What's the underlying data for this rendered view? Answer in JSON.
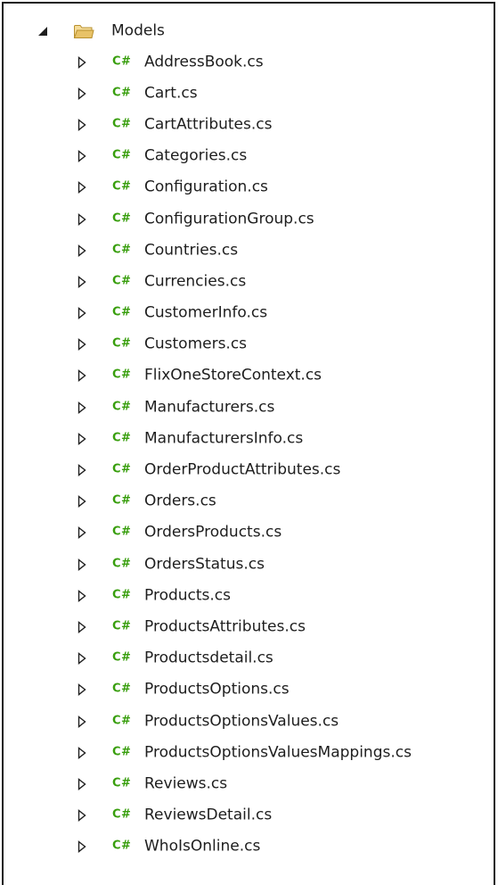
{
  "tree": {
    "root": {
      "label": "Models",
      "icon": "folder-open-icon",
      "expander_icon": "triangle-expanded-icon"
    },
    "file_badge": "C#",
    "file_icon": "csharp-file-icon",
    "collapsed_icon": "triangle-collapsed-icon",
    "files": [
      {
        "label": "AddressBook.cs"
      },
      {
        "label": "Cart.cs"
      },
      {
        "label": "CartAttributes.cs"
      },
      {
        "label": "Categories.cs"
      },
      {
        "label": "Configuration.cs"
      },
      {
        "label": "ConfigurationGroup.cs"
      },
      {
        "label": "Countries.cs"
      },
      {
        "label": "Currencies.cs"
      },
      {
        "label": "CustomerInfo.cs"
      },
      {
        "label": "Customers.cs"
      },
      {
        "label": "FlixOneStoreContext.cs"
      },
      {
        "label": "Manufacturers.cs"
      },
      {
        "label": "ManufacturersInfo.cs"
      },
      {
        "label": "OrderProductAttributes.cs"
      },
      {
        "label": "Orders.cs"
      },
      {
        "label": "OrdersProducts.cs"
      },
      {
        "label": "OrdersStatus.cs"
      },
      {
        "label": "Products.cs"
      },
      {
        "label": "ProductsAttributes.cs"
      },
      {
        "label": "Productsdetail.cs"
      },
      {
        "label": "ProductsOptions.cs"
      },
      {
        "label": "ProductsOptionsValues.cs"
      },
      {
        "label": "ProductsOptionsValuesMappings.cs"
      },
      {
        "label": "Reviews.cs"
      },
      {
        "label": "ReviewsDetail.cs"
      },
      {
        "label": "WhoIsOnline.cs"
      }
    ]
  },
  "colors": {
    "csharp_badge": "#389e0d",
    "text": "#1e1e1e",
    "expander": "#1e1e1e",
    "folder_fill": "#e8c267",
    "folder_stroke": "#b8902e",
    "border": "#1a1a1a"
  }
}
